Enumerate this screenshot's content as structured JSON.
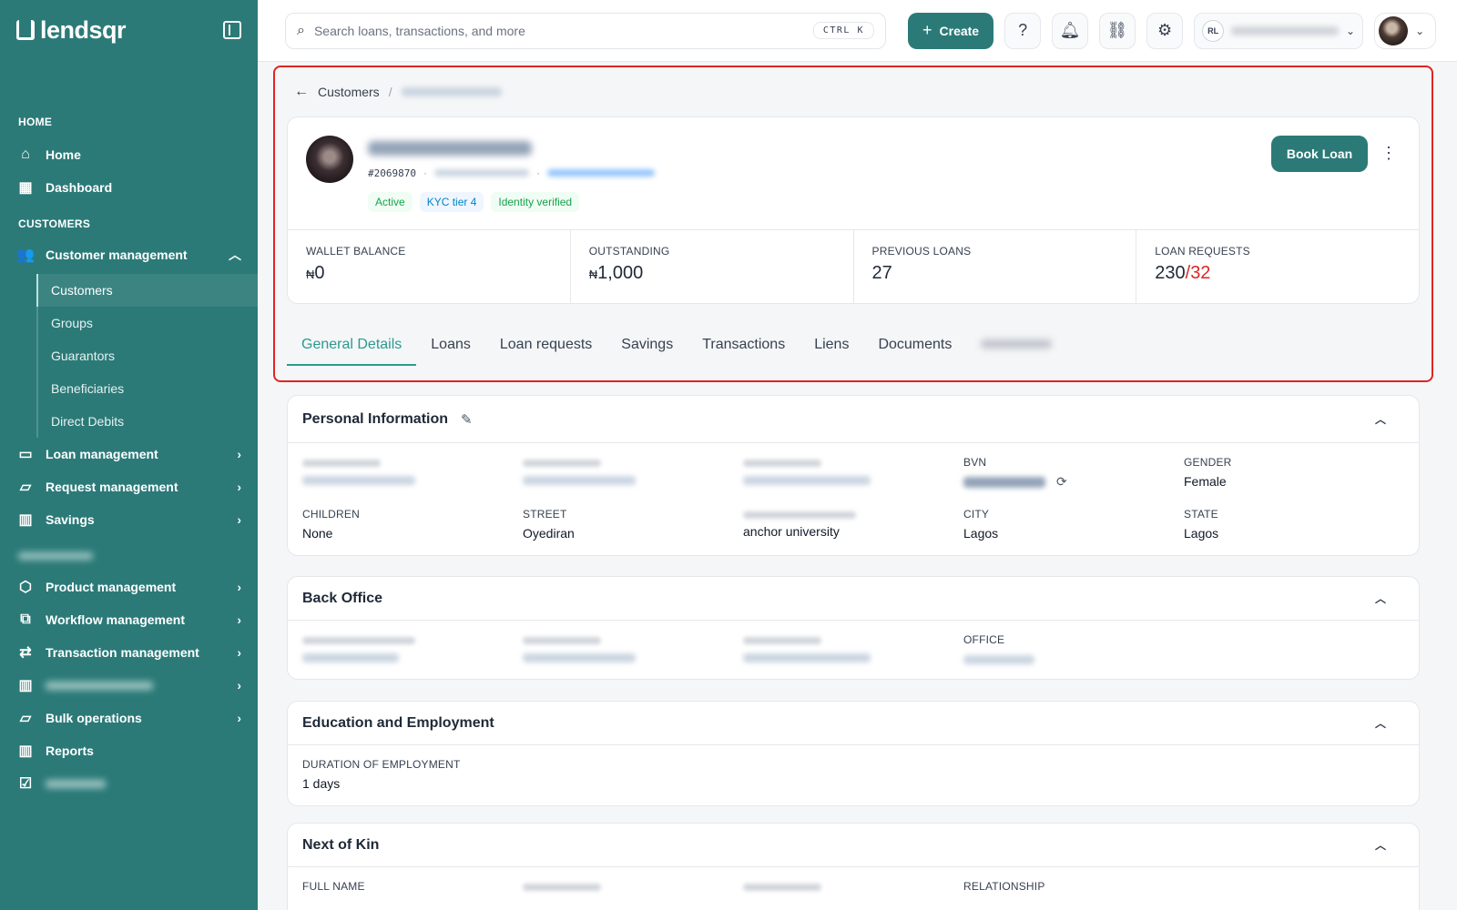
{
  "brand": {
    "name": "lendsqr"
  },
  "sidebar": {
    "sections": {
      "home": "HOME",
      "customers": "CUSTOMERS"
    },
    "home_items": [
      {
        "label": "Home",
        "icon": "home-icon"
      },
      {
        "label": "Dashboard",
        "icon": "dashboard-icon"
      }
    ],
    "customer_management": {
      "label": "Customer management",
      "icon": "users-icon"
    },
    "sub_items": [
      {
        "label": "Customers",
        "active": true
      },
      {
        "label": "Groups"
      },
      {
        "label": "Guarantors"
      },
      {
        "label": "Beneficiaries"
      },
      {
        "label": "Direct Debits"
      }
    ],
    "more_items": [
      {
        "label": "Loan management",
        "icon": "loan-icon"
      },
      {
        "label": "Request management",
        "icon": "inbox-icon"
      },
      {
        "label": "Savings",
        "icon": "savings-icon"
      }
    ],
    "back_office_items": [
      {
        "label": "Product management",
        "icon": "package-icon"
      },
      {
        "label": "Workflow management",
        "icon": "workflow-icon"
      },
      {
        "label": "Transaction management",
        "icon": "transfer-icon"
      }
    ],
    "bottom_items": [
      {
        "label": "Bulk operations",
        "icon": "inbox-icon"
      },
      {
        "label": "Reports",
        "icon": "chart-icon"
      }
    ]
  },
  "topbar": {
    "search_placeholder": "Search loans, transactions, and more",
    "shortcut": "CTRL K",
    "create_label": "Create",
    "org_initials": "RL"
  },
  "breadcrumb": {
    "root": "Customers"
  },
  "profile": {
    "customer_id": "#2069870",
    "badges": [
      "Active",
      "KYC tier 4",
      "Identity verified"
    ],
    "book_loan_label": "Book Loan",
    "stats": [
      {
        "label": "WALLET BALANCE",
        "currency": "₦",
        "value": "0"
      },
      {
        "label": "OUTSTANDING",
        "currency": "₦",
        "value": "1,000"
      },
      {
        "label": "PREVIOUS LOANS",
        "value": "27"
      },
      {
        "label": "LOAN REQUESTS",
        "value": "230",
        "slash": "/",
        "value_red": "32"
      }
    ]
  },
  "tabs": [
    "General Details",
    "Loans",
    "Loan requests",
    "Savings",
    "Transactions",
    "Liens",
    "Documents"
  ],
  "personal": {
    "title": "Personal Information",
    "bvn_label": "BVN",
    "gender_label": "GENDER",
    "gender": "Female",
    "children_label": "CHILDREN",
    "children": "None",
    "street_label": "STREET",
    "street": "Oyediran",
    "nearest_landmark": "anchor university",
    "city_label": "CITY",
    "city": "Lagos",
    "state_label": "STATE",
    "state": "Lagos"
  },
  "back_office": {
    "title": "Back Office",
    "office_label": "OFFICE"
  },
  "education": {
    "title": "Education and Employment",
    "duration_label": "DURATION OF EMPLOYMENT",
    "duration": "1 days"
  },
  "next_of_kin": {
    "title": "Next of Kin",
    "full_name_label": "FULL NAME",
    "relationship_label": "RELATIONSHIP"
  },
  "colors": {
    "brand": "#2b7a78",
    "accent_tab": "#2b9a8f",
    "highlight": "#e02424",
    "red_value": "#dc2626"
  }
}
